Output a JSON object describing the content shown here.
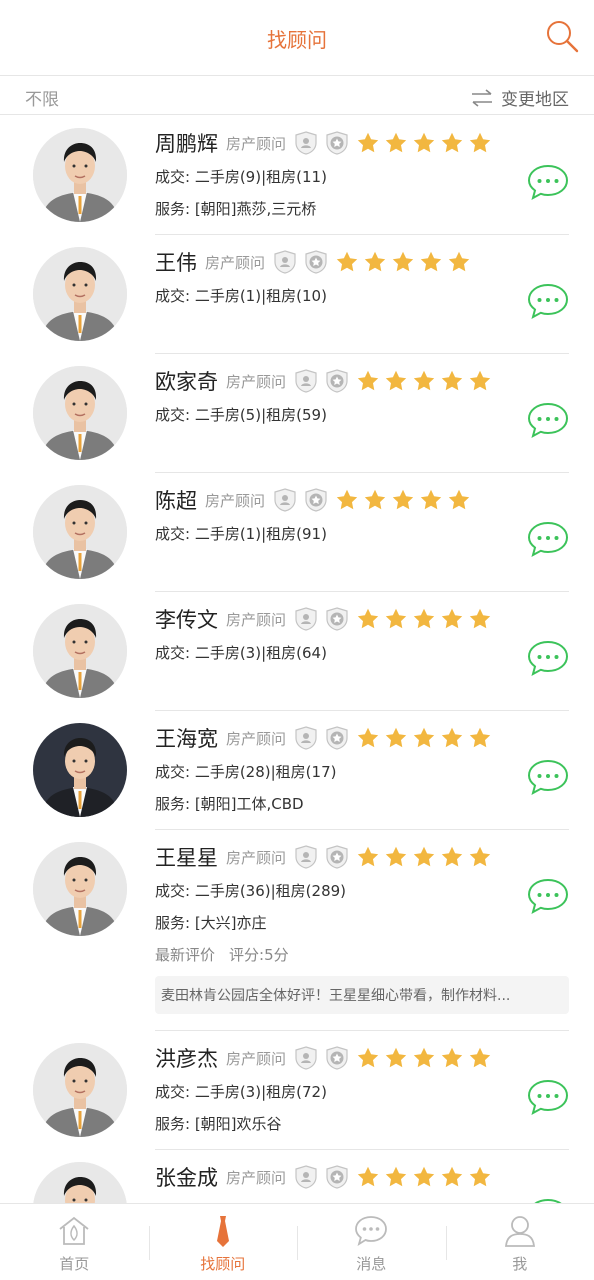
{
  "header": {
    "title": "找顾问",
    "search_icon": "search-icon"
  },
  "filter": {
    "unlimited": "不限",
    "change_region": "变更地区",
    "swap_icon": "swap-arrows-icon"
  },
  "colors": {
    "accent": "#e6733a",
    "star": "#f2b740",
    "chat_green": "#3cc35a"
  },
  "advisors": [
    {
      "name": "周鹏辉",
      "role": "房产顾问",
      "rating": 5,
      "deals": "成交: 二手房(9)|租房(11)",
      "service": "服务: [朝阳]燕莎,三元桥",
      "suit": "grey"
    },
    {
      "name": "王伟",
      "role": "房产顾问",
      "rating": 5,
      "deals": "成交: 二手房(1)|租房(10)",
      "service": "",
      "suit": "grey"
    },
    {
      "name": "欧家奇",
      "role": "房产顾问",
      "rating": 5,
      "deals": "成交: 二手房(5)|租房(59)",
      "service": "",
      "suit": "grey"
    },
    {
      "name": "陈超",
      "role": "房产顾问",
      "rating": 5,
      "deals": "成交: 二手房(1)|租房(91)",
      "service": "",
      "suit": "grey"
    },
    {
      "name": "李传文",
      "role": "房产顾问",
      "rating": 5,
      "deals": "成交: 二手房(3)|租房(64)",
      "service": "",
      "suit": "grey"
    },
    {
      "name": "王海宽",
      "role": "房产顾问",
      "rating": 5,
      "deals": "成交: 二手房(28)|租房(17)",
      "service": "服务: [朝阳]工体,CBD",
      "suit": "dark"
    },
    {
      "name": "王星星",
      "role": "房产顾问",
      "rating": 5,
      "deals": "成交: 二手房(36)|租房(289)",
      "service": "服务: [大兴]亦庄",
      "suit": "grey",
      "eval_label": "最新评价",
      "eval_score": "评分:5分",
      "review": "麦田林肯公园店全体好评！王星星细心带看，制作材料..."
    },
    {
      "name": "洪彦杰",
      "role": "房产顾问",
      "rating": 5,
      "deals": "成交: 二手房(3)|租房(72)",
      "service": "服务: [朝阳]欢乐谷",
      "suit": "grey"
    },
    {
      "name": "张金成",
      "role": "房产顾问",
      "rating": 5,
      "deals": "",
      "service": "",
      "suit": "grey"
    }
  ],
  "tabs": [
    {
      "label": "首页",
      "icon": "home-icon",
      "active": false
    },
    {
      "label": "找顾问",
      "icon": "tie-icon",
      "active": true
    },
    {
      "label": "消息",
      "icon": "message-icon",
      "active": false
    },
    {
      "label": "我",
      "icon": "user-icon",
      "active": false
    }
  ]
}
